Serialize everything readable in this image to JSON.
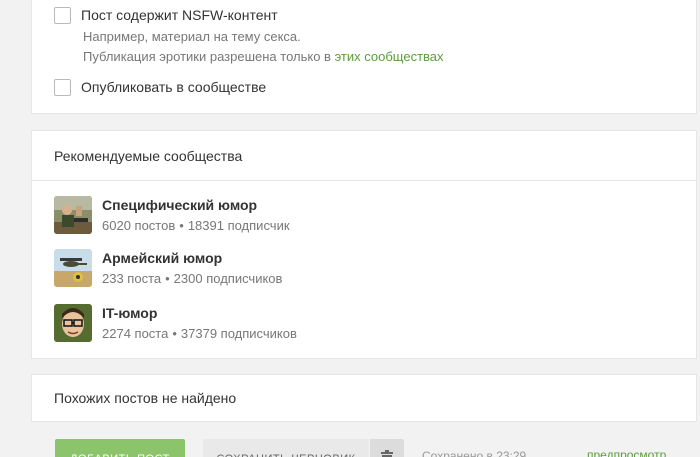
{
  "options": {
    "nsfw_label": "Пост содержит NSFW-контент",
    "nsfw_hint_1": "Например, материал на тему секса.",
    "nsfw_hint_2_prefix": "Публикация эротики разрешена только в ",
    "nsfw_hint_2_link": "этих сообществах",
    "community_label": "Опубликовать в сообществе"
  },
  "recommended": {
    "title": "Рекомендуемые сообщества",
    "items": [
      {
        "name": "Специфический юмор",
        "posts": "6020 постов",
        "subscribers": "18391 подписчик",
        "avatar": "specific-humor-avatar"
      },
      {
        "name": "Армейский юмор",
        "posts": "233 поста",
        "subscribers": "2300 подписчиков",
        "avatar": "army-humor-avatar"
      },
      {
        "name": "IT-юмор",
        "posts": "2274 поста",
        "subscribers": "37379 подписчиков",
        "avatar": "it-humor-avatar"
      }
    ],
    "separator": "•"
  },
  "similar": {
    "text": "Похожих постов не найдено"
  },
  "toolbar": {
    "add_label": "ДОБАВИТЬ ПОСТ",
    "draft_label": "СОХРАНИТЬ ЧЕРНОВИК",
    "trash_icon": "trash-icon",
    "saved_text": "Сохранено в 23:29",
    "preview_label": "предпросмотр"
  },
  "colors": {
    "accent_green": "#8bc46b",
    "link_green": "#5a9e3d",
    "background": "#f2f2f2"
  }
}
